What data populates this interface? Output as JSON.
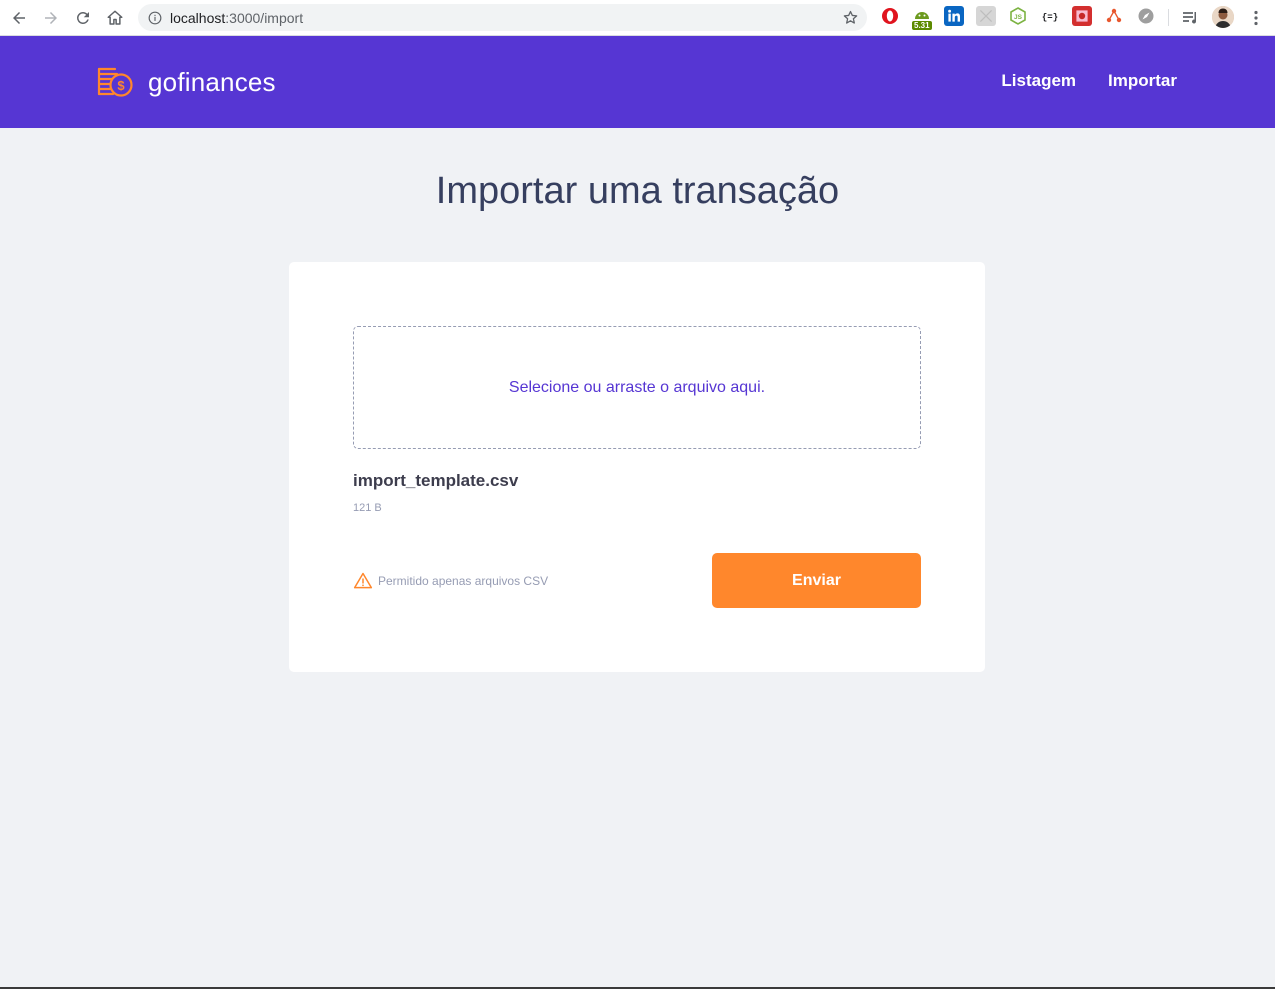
{
  "browser": {
    "url_host": "localhost",
    "url_path": ":3000/import",
    "extension_badge": "5.31",
    "icons": [
      "back-icon",
      "forward-icon",
      "reload-icon",
      "home-icon",
      "info-icon",
      "star-icon",
      "opera-icon",
      "android-icon",
      "linkedin-icon",
      "puzzle-icon",
      "nodejs-icon",
      "json-icon",
      "extension-red-icon",
      "network-icon",
      "compass-icon",
      "queue-icon",
      "avatar",
      "more-icon"
    ]
  },
  "header": {
    "brand": "gofinances",
    "nav": [
      {
        "label": "Listagem"
      },
      {
        "label": "Importar"
      }
    ]
  },
  "main": {
    "title": "Importar uma transação",
    "dropzone_text": "Selecione ou arraste o arquivo aqui.",
    "file": {
      "name": "import_template.csv",
      "size": "121 B"
    },
    "warning": "Permitido apenas arquivos CSV",
    "submit_label": "Enviar"
  },
  "colors": {
    "primary": "#5636d3",
    "accent": "#ff872c",
    "title": "#363f5f",
    "muted": "#969cb3",
    "background": "#f0f2f5"
  }
}
